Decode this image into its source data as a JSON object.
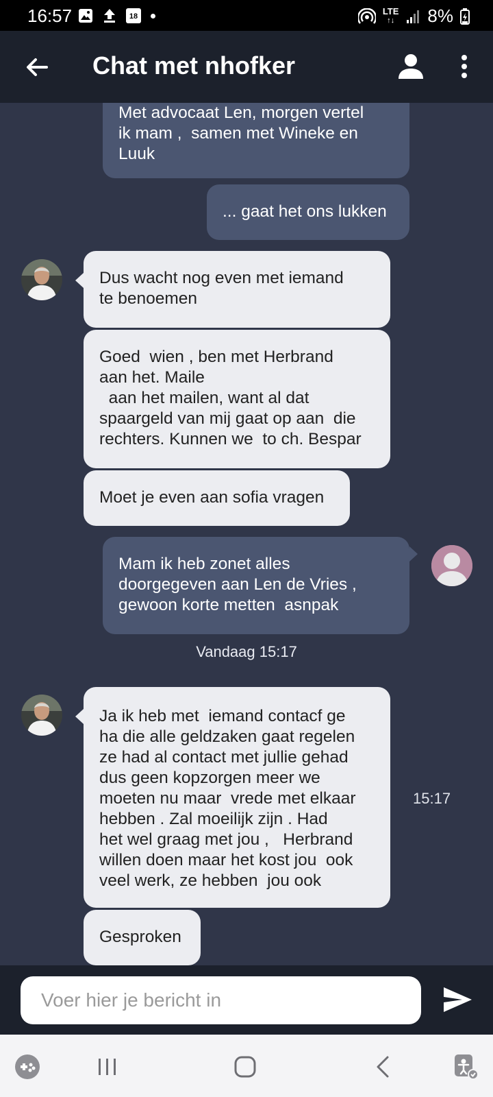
{
  "status_bar": {
    "time": "16:57",
    "calendar_day": "18",
    "network": "LTE",
    "battery": "8%"
  },
  "header": {
    "title": "Chat met nhofker"
  },
  "messages": [
    {
      "direction": "outgoing",
      "text": "Met advocaat Len, morgen vertel\nik mam ,  samen met Wineke en\nLuuk"
    },
    {
      "direction": "outgoing",
      "text": "... gaat het ons lukken"
    },
    {
      "direction": "incoming",
      "text": "Dus wacht nog even met iemand\nte benoemen"
    },
    {
      "direction": "incoming",
      "text": "Goed  wien , ben met Herbrand\naan het. Maile\n  aan het mailen, want al dat\nspaargeld van mij gaat op aan  die\nrechters. Kunnen we  to ch. Bespar"
    },
    {
      "direction": "incoming",
      "text": "Moet je even aan sofia vragen"
    },
    {
      "direction": "outgoing",
      "text": "Mam ik heb zonet alles\ndoorgegeven aan Len de Vries ,\ngewoon korte metten  asnpak"
    },
    {
      "direction": "incoming",
      "text": "Ja ik heb met  iemand contacf ge\nha die alle geldzaken gaat regelen\nze had al contact met jullie gehad\ndus geen kopzorgen meer we\nmoeten nu maar  vrede met elkaar\nhebben . Zal moeilijk zijn . Had\nhet wel graag met jou ,   Herbrand\nwillen doen maar het kost jou  ook\nveel werk, ze hebben  jou ook",
      "time": "15:17"
    },
    {
      "direction": "incoming",
      "text": "Gesproken"
    }
  ],
  "date_separator": "Vandaag 15:17",
  "composer": {
    "placeholder": "Voer hier je bericht in"
  },
  "colors": {
    "chat_background": "#303649",
    "app_bar": "#1c212c",
    "outgoing_bubble": "#4b5671",
    "incoming_bubble": "#ecedf1"
  },
  "icons": [
    "back-arrow-icon",
    "person-icon",
    "more-vert-icon",
    "send-icon",
    "game-launcher-icon",
    "recent-apps-icon",
    "home-icon",
    "nav-back-icon",
    "accessibility-icon"
  ]
}
